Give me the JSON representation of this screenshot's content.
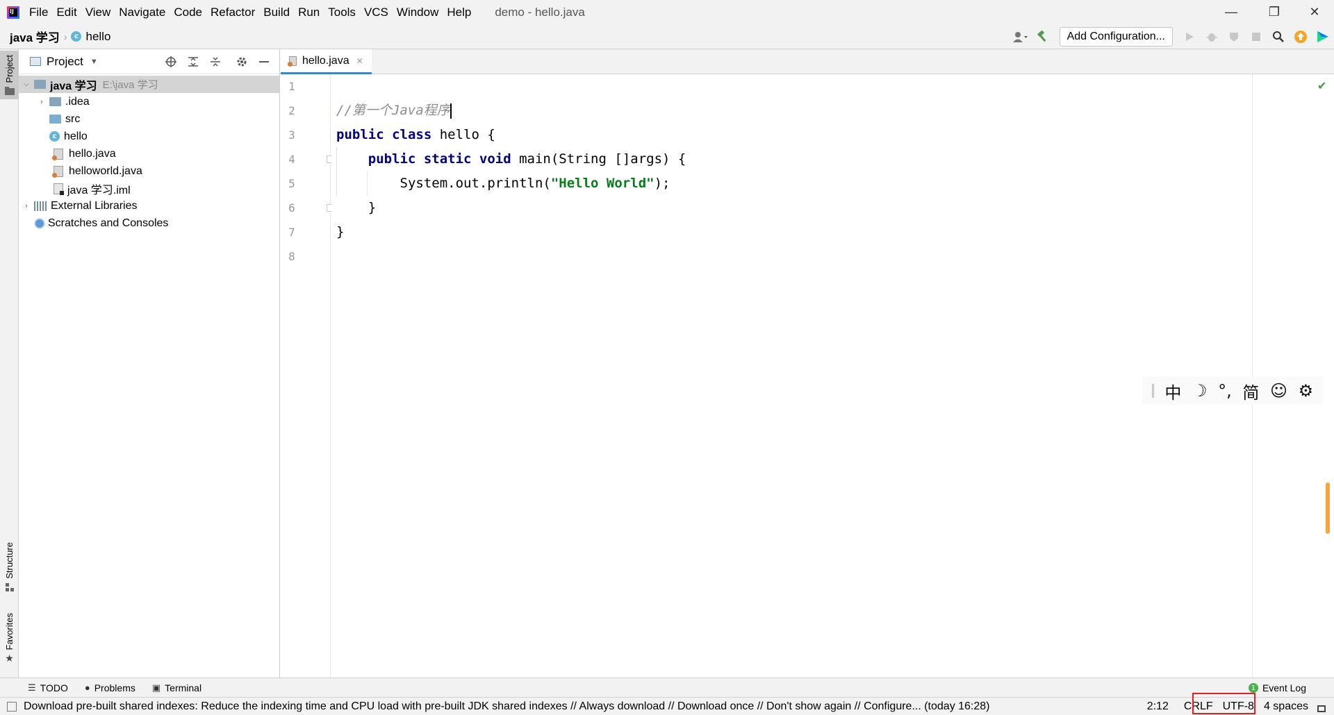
{
  "app": {
    "logo_text": "IJ",
    "window_title": "demo - hello.java",
    "menu": [
      "File",
      "Edit",
      "View",
      "Navigate",
      "Code",
      "Refactor",
      "Build",
      "Run",
      "Tools",
      "VCS",
      "Window",
      "Help"
    ],
    "window_controls": [
      "—",
      "❐",
      "✕"
    ]
  },
  "navbar": {
    "project": "java 学习",
    "file": "hello",
    "class_icon_letter": "c",
    "add_configuration": "Add Configuration...",
    "icons": [
      "user-icon",
      "build-hammer-icon",
      "run-icon",
      "debug-icon",
      "coverage-icon",
      "stop-icon",
      "search-icon",
      "update-icon",
      "jetbrains-toolbox-icon"
    ]
  },
  "left_stripe": {
    "project": "Project",
    "structure": "Structure",
    "favorites": "Favorites"
  },
  "project_panel": {
    "title": "Project",
    "tree": [
      {
        "name": "java 学习",
        "path": "E:\\java 学习",
        "type": "module",
        "expanded": true,
        "selected": true
      },
      {
        "name": ".idea",
        "type": "folder",
        "expanded": false
      },
      {
        "name": "src",
        "type": "source-folder"
      },
      {
        "name": "hello",
        "type": "class"
      },
      {
        "name": "hello.java",
        "type": "java-file"
      },
      {
        "name": "helloworld.java",
        "type": "java-file"
      },
      {
        "name": "java 学习.iml",
        "type": "iml-file"
      },
      {
        "name": "External Libraries",
        "type": "libraries",
        "expanded": false
      },
      {
        "name": "Scratches and Consoles",
        "type": "scratches"
      }
    ]
  },
  "editor": {
    "tab": "hello.java",
    "tab_close": "✕",
    "line_numbers": [
      "1",
      "2",
      "3",
      "4",
      "5",
      "6",
      "7",
      "8"
    ],
    "current_line": 2,
    "code": {
      "line2_comment": "//第一个Java程序",
      "line3_kw": "public class ",
      "line3_rest": "hello {",
      "line4_kw": "public static void ",
      "line4_rest": "main(String []args) {",
      "line5_pre": "System.out.println(",
      "line5_str": "\"Hello World\"",
      "line5_post": ");",
      "line6": "}",
      "line7": "}"
    },
    "inspection_status": "✔"
  },
  "ime_bar": {
    "items": [
      "中",
      "☽",
      "°,",
      "简",
      "☺",
      "⚙"
    ]
  },
  "bottom_tools": {
    "todo": "TODO",
    "problems": "Problems",
    "terminal": "Terminal",
    "event_log": "Event Log",
    "event_count": "1"
  },
  "statusbar": {
    "message": "Download pre-built shared indexes: Reduce the indexing time and CPU load with pre-built JDK shared indexes // Always download // Download once // Don't show again // Configure... (today 16:28)",
    "position": "2:12",
    "line_separator": "CRLF",
    "encoding": "UTF-8",
    "indent": "4 spaces"
  },
  "colors": {
    "keyword": "#000080",
    "string": "#067d17",
    "comment": "#8c8c8c",
    "highlight_box": "#e02020",
    "current_line": "#fdfbe9"
  }
}
